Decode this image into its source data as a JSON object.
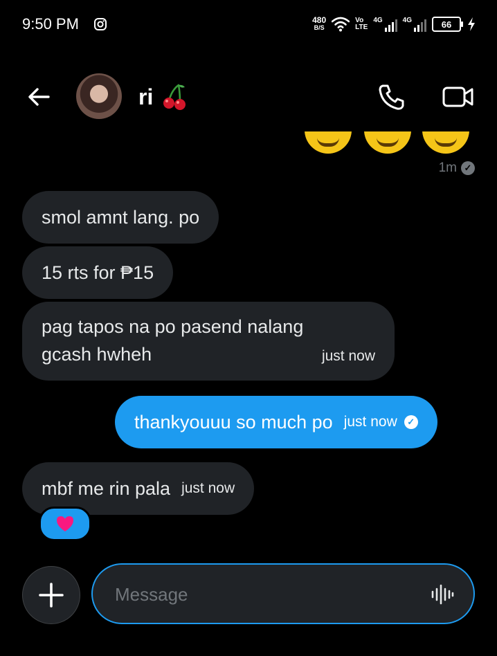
{
  "status_bar": {
    "time": "9:50 PM",
    "speed_value": "480",
    "speed_unit": "B/S",
    "volte_top": "Vo",
    "volte_bottom": "LTE",
    "net1": "4G",
    "net2": "4G",
    "battery": "66",
    "icons": [
      "instagram-icon",
      "wifi-icon",
      "signal-icon",
      "battery-icon",
      "charging-icon"
    ]
  },
  "header": {
    "contact_name": "ri",
    "icons": [
      "back-arrow-icon",
      "cherry-icon",
      "phone-icon",
      "video-camera-icon"
    ]
  },
  "chat": {
    "prev_timestamp": "1m",
    "messages": [
      {
        "from": "them",
        "text": "smol amnt lang. po"
      },
      {
        "from": "them",
        "text": "15 rts for ₱15"
      },
      {
        "from": "them",
        "text_line1": "pag tapos na po pasend nalang",
        "text_line2": "gcash hwheh",
        "time": "just now"
      },
      {
        "from": "me",
        "text": "thankyouuu so much po",
        "time": "just now"
      },
      {
        "from": "them",
        "text": "mbf me rin pala",
        "time": "just now",
        "reaction": "heart"
      }
    ]
  },
  "composer": {
    "placeholder": "Message",
    "icons": [
      "plus-icon",
      "voice-wave-icon"
    ]
  },
  "colors": {
    "background": "#000000",
    "incoming_bubble": "#202327",
    "outgoing_bubble": "#1d9bf0",
    "accent": "#1d9bf0",
    "heart": "#f91880"
  }
}
